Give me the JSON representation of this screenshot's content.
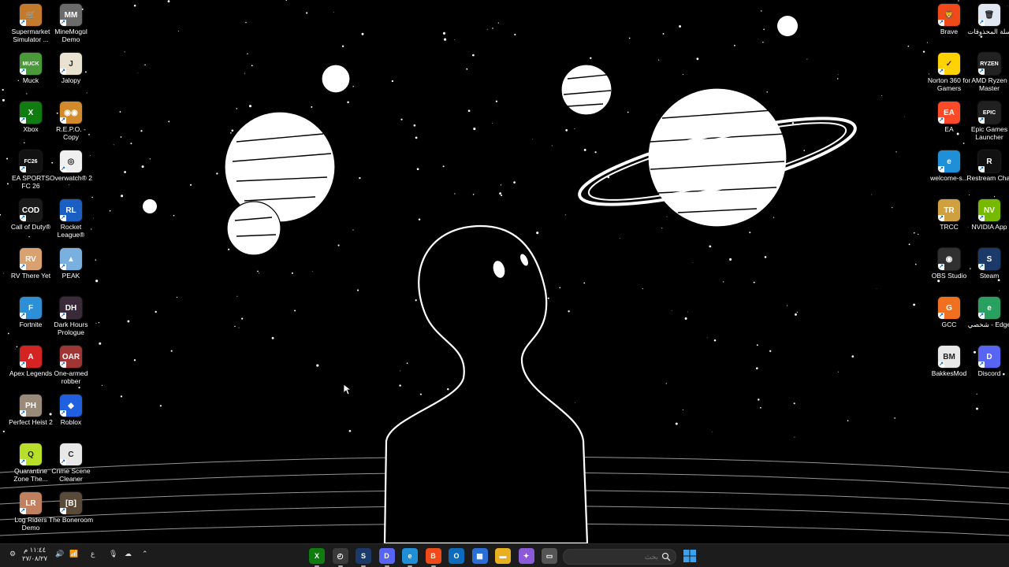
{
  "desktop": {
    "left_icons": [
      {
        "label": "Supermarket Simulator ...",
        "icon": "supermarket-icon",
        "color": "#c47a2c",
        "glyph": "🛒"
      },
      {
        "label": "MineMogul Demo",
        "icon": "minemogul-icon",
        "color": "#6b6b6b",
        "glyph": "MM"
      },
      {
        "label": "Muck",
        "icon": "muck-icon",
        "color": "#4a9a3a",
        "glyph": "MUCK"
      },
      {
        "label": "Jalopy",
        "icon": "jalopy-icon",
        "color": "#e9e2d0",
        "glyph": "J"
      },
      {
        "label": "Xbox",
        "icon": "xbox-icon",
        "color": "#107c10",
        "glyph": "X"
      },
      {
        "label": "R.E.P.O. - Copy",
        "icon": "repo-icon",
        "color": "#d28a2a",
        "glyph": "◉◉"
      },
      {
        "label": "EA SPORTS FC 26",
        "icon": "ea-fc-icon",
        "color": "#111111",
        "glyph": "FC26"
      },
      {
        "label": "Overwatch® 2",
        "icon": "overwatch-icon",
        "color": "#f0f0f0",
        "glyph": "◎"
      },
      {
        "label": "Call of Duty®",
        "icon": "call-of-duty-icon",
        "color": "#1a1a1a",
        "glyph": "COD"
      },
      {
        "label": "Rocket League®",
        "icon": "rocket-league-icon",
        "color": "#1b5fc4",
        "glyph": "RL"
      },
      {
        "label": "RV There Yet",
        "icon": "rv-there-yet-icon",
        "color": "#d9a070",
        "glyph": "RV"
      },
      {
        "label": "PEAK",
        "icon": "peak-icon",
        "color": "#7ab0e0",
        "glyph": "▲"
      },
      {
        "label": "Fortnite",
        "icon": "fortnite-icon",
        "color": "#2d8fd5",
        "glyph": "F"
      },
      {
        "label": "Dark Hours Prologue",
        "icon": "dark-hours-icon",
        "color": "#3a2a3a",
        "glyph": "DH"
      },
      {
        "label": "Apex Legends",
        "icon": "apex-legends-icon",
        "color": "#d42323",
        "glyph": "A"
      },
      {
        "label": "One-armed robber",
        "icon": "one-armed-robber-icon",
        "color": "#a03535",
        "glyph": "OAR"
      },
      {
        "label": "Perfect Heist 2",
        "icon": "perfect-heist-icon",
        "color": "#9a8a7a",
        "glyph": "PH"
      },
      {
        "label": "Roblox",
        "icon": "roblox-icon",
        "color": "#1f5fe0",
        "glyph": "◆"
      },
      {
        "label": "Quarantine Zone The...",
        "icon": "quarantine-zone-icon",
        "color": "#b8e02a",
        "glyph": "Q"
      },
      {
        "label": "Crime Scene Cleaner",
        "icon": "crime-scene-cleaner-icon",
        "color": "#e8e8e8",
        "glyph": "C"
      },
      {
        "label": "Log Riders Demo",
        "icon": "log-riders-icon",
        "color": "#c08060",
        "glyph": "LR"
      },
      {
        "label": "The Boneroom",
        "icon": "boneroom-icon",
        "color": "#5a4a3a",
        "glyph": "[B]"
      }
    ],
    "right_icons": [
      {
        "label": "Brave",
        "icon": "brave-icon",
        "color": "#f04a1a",
        "glyph": "🦁"
      },
      {
        "label": "سلة المحذوفات",
        "icon": "recycle-bin-icon",
        "color": "#dfe8f2",
        "glyph": "🗑"
      },
      {
        "label": "Norton 360 for Gamers",
        "icon": "norton-icon",
        "color": "#ffd200",
        "glyph": "✓"
      },
      {
        "label": "AMD Ryzen Master",
        "icon": "amd-ryzen-icon",
        "color": "#222222",
        "glyph": "RYZEN"
      },
      {
        "label": "EA",
        "icon": "ea-icon",
        "color": "#ff4a2a",
        "glyph": "EA"
      },
      {
        "label": "Epic Games Launcher",
        "icon": "epic-games-icon",
        "color": "#202020",
        "glyph": "EPIC"
      },
      {
        "label": "welcome-s...",
        "icon": "edge-icon",
        "color": "#1f8fd8",
        "glyph": "e"
      },
      {
        "label": "Restream Chat",
        "icon": "restream-icon",
        "color": "#111111",
        "glyph": "R"
      },
      {
        "label": "TRCC",
        "icon": "trcc-icon",
        "color": "#d0a040",
        "glyph": "TR"
      },
      {
        "label": "NVIDIA App",
        "icon": "nvidia-icon",
        "color": "#76b900",
        "glyph": "NV"
      },
      {
        "label": "OBS Studio",
        "icon": "obs-icon",
        "color": "#303030",
        "glyph": "◉"
      },
      {
        "label": "Steam",
        "icon": "steam-icon",
        "color": "#1b3a6a",
        "glyph": "S"
      },
      {
        "label": "GCC",
        "icon": "gcc-icon",
        "color": "#f07020",
        "glyph": "G"
      },
      {
        "label": "شخصي - Edge",
        "icon": "edge-personal-icon",
        "color": "#2aa060",
        "glyph": "e"
      },
      {
        "label": "BakkesMod",
        "icon": "bakkesmod-icon",
        "color": "#e8e8e8",
        "glyph": "BM"
      },
      {
        "label": "Discord",
        "icon": "discord-icon",
        "color": "#5865f2",
        "glyph": "D"
      }
    ]
  },
  "taskbar": {
    "search_placeholder": "بحث",
    "clock_time": "١١:٤٤ م",
    "clock_date": "٢٧/٠٨/٢٧",
    "lang_indicator": "ع",
    "apps": [
      {
        "name": "xbox-app",
        "color": "#107c10",
        "glyph": "X"
      },
      {
        "name": "clock-app",
        "color": "#3a3a3a",
        "glyph": "◴"
      },
      {
        "name": "steam-app",
        "color": "#1b3a6a",
        "glyph": "S"
      },
      {
        "name": "discord-app",
        "color": "#5865f2",
        "glyph": "D"
      },
      {
        "name": "edge-app",
        "color": "#1f8fd8",
        "glyph": "e"
      },
      {
        "name": "brave-app",
        "color": "#f04a1a",
        "glyph": "B"
      },
      {
        "name": "outlook-app",
        "color": "#0f6cbd",
        "glyph": "O"
      },
      {
        "name": "store-app",
        "color": "#2a6fd8",
        "glyph": "▦"
      },
      {
        "name": "file-explorer-app",
        "color": "#e8b020",
        "glyph": "▬"
      },
      {
        "name": "copilot-app",
        "color": "#8a5ad8",
        "glyph": "✦"
      },
      {
        "name": "desktop-app",
        "color": "#555555",
        "glyph": "▭"
      }
    ]
  }
}
